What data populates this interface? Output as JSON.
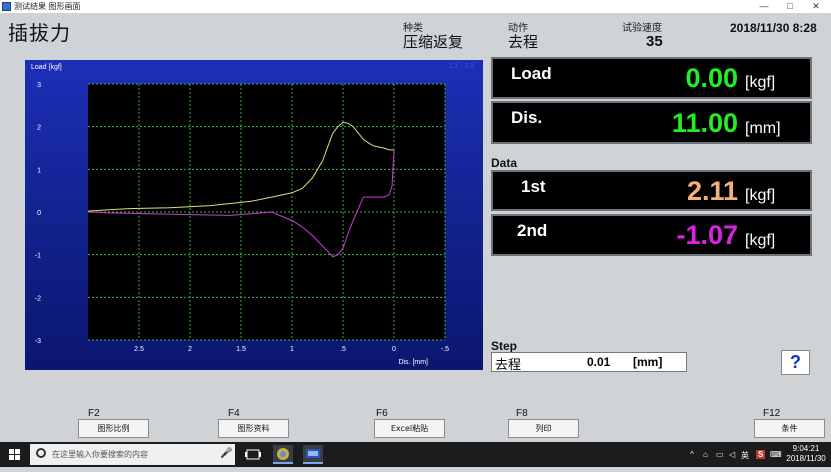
{
  "window": {
    "title": "测试结果  图形画面",
    "min": "—",
    "max": "□",
    "close": "✕"
  },
  "header": {
    "title": "插拔力",
    "type_label": "种类",
    "type_value": "压缩返复",
    "action_label": "动作",
    "action_value": "去程",
    "speed_label": "试验速度",
    "speed_value": "35",
    "datetime": "2018/11/30 8:28"
  },
  "chart_data": {
    "type": "line",
    "ylabel": "Load [kgf]",
    "xlabel": "Dis. [mm]",
    "corner_label": "1.1 : 3.3",
    "xlim": [
      3.0,
      -0.5
    ],
    "ylim": [
      -3,
      3
    ],
    "x_ticks": [
      "2.5",
      "2",
      "1.5",
      "1",
      ".5",
      "0",
      "-.5"
    ],
    "y_ticks": [
      "3",
      "2",
      "1",
      "0",
      "-1",
      "-2",
      "-3"
    ],
    "grid": true,
    "series": [
      {
        "color": "#d8e07a",
        "x": [
          3.0,
          2.6,
          2.2,
          1.8,
          1.4,
          1.2,
          1.0,
          0.9,
          0.8,
          0.7,
          0.6,
          0.55,
          0.5,
          0.45,
          0.4,
          0.35,
          0.3,
          0.25,
          0.2,
          0.1,
          0.05,
          0.0
        ],
        "y": [
          0.02,
          0.08,
          0.1,
          0.15,
          0.25,
          0.35,
          0.45,
          0.55,
          0.8,
          1.2,
          1.85,
          2.0,
          2.1,
          2.08,
          2.0,
          1.85,
          1.7,
          1.62,
          1.55,
          1.5,
          1.46,
          1.45
        ]
      },
      {
        "color": "#cc3ad9",
        "x": [
          0.0,
          0.02,
          0.05,
          0.1,
          0.3,
          0.4,
          0.45,
          0.5,
          0.55,
          0.6,
          0.7,
          0.8,
          0.9,
          1.0,
          1.2,
          1.6,
          2.0,
          2.4,
          2.8,
          3.0
        ],
        "y": [
          1.45,
          0.6,
          0.4,
          0.35,
          0.35,
          -0.2,
          -0.5,
          -0.85,
          -1.0,
          -1.05,
          -0.8,
          -0.55,
          -0.35,
          -0.2,
          0.0,
          -0.08,
          -0.06,
          -0.04,
          -0.02,
          0.0
        ]
      }
    ]
  },
  "readouts": {
    "load": {
      "label": "Load",
      "value": "0.00",
      "unit": "[kgf]",
      "color": "#22ee22"
    },
    "dis": {
      "label": "Dis.",
      "value": "11.00",
      "unit": "[mm]",
      "color": "#22ee22"
    },
    "data_title": "Data",
    "first": {
      "label": "1st",
      "value": "2.11",
      "unit": "[kgf]",
      "color": "#f4b27a"
    },
    "second": {
      "label": "2nd",
      "value": "-1.07",
      "unit": "[kgf]",
      "color": "#e020e6"
    }
  },
  "step": {
    "title": "Step",
    "action": "去程",
    "value": "0.01",
    "unit": "[mm]"
  },
  "help": "?",
  "fkeys": [
    {
      "key": "F2",
      "label": "图形比例"
    },
    {
      "key": "F4",
      "label": "图形资料"
    },
    {
      "key": "F6",
      "label": "Excel粘贴"
    },
    {
      "key": "F8",
      "label": "列印"
    },
    {
      "key": "F12",
      "label": "条件"
    }
  ],
  "taskbar": {
    "search_placeholder": "在这里输入你要搜索的内容",
    "ime": "英",
    "time": "9:04:21",
    "date": "2018/11/30"
  }
}
